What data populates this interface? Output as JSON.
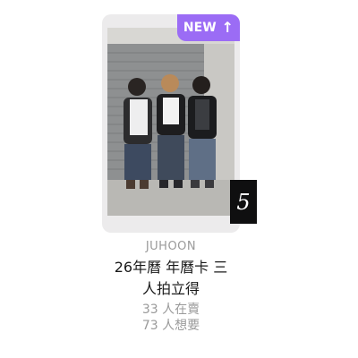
{
  "card": {
    "badge_label": "NEW",
    "badge_arrow": "↑",
    "badge_color": "#9b6cf5",
    "rank": "5",
    "artist": "JUHOON",
    "title_line1": "26年曆 年曆卡 三",
    "title_line2": "人拍立得",
    "selling": "33 人在賣",
    "wanting": "73 人想要",
    "image_icon": "photo-three-people"
  }
}
